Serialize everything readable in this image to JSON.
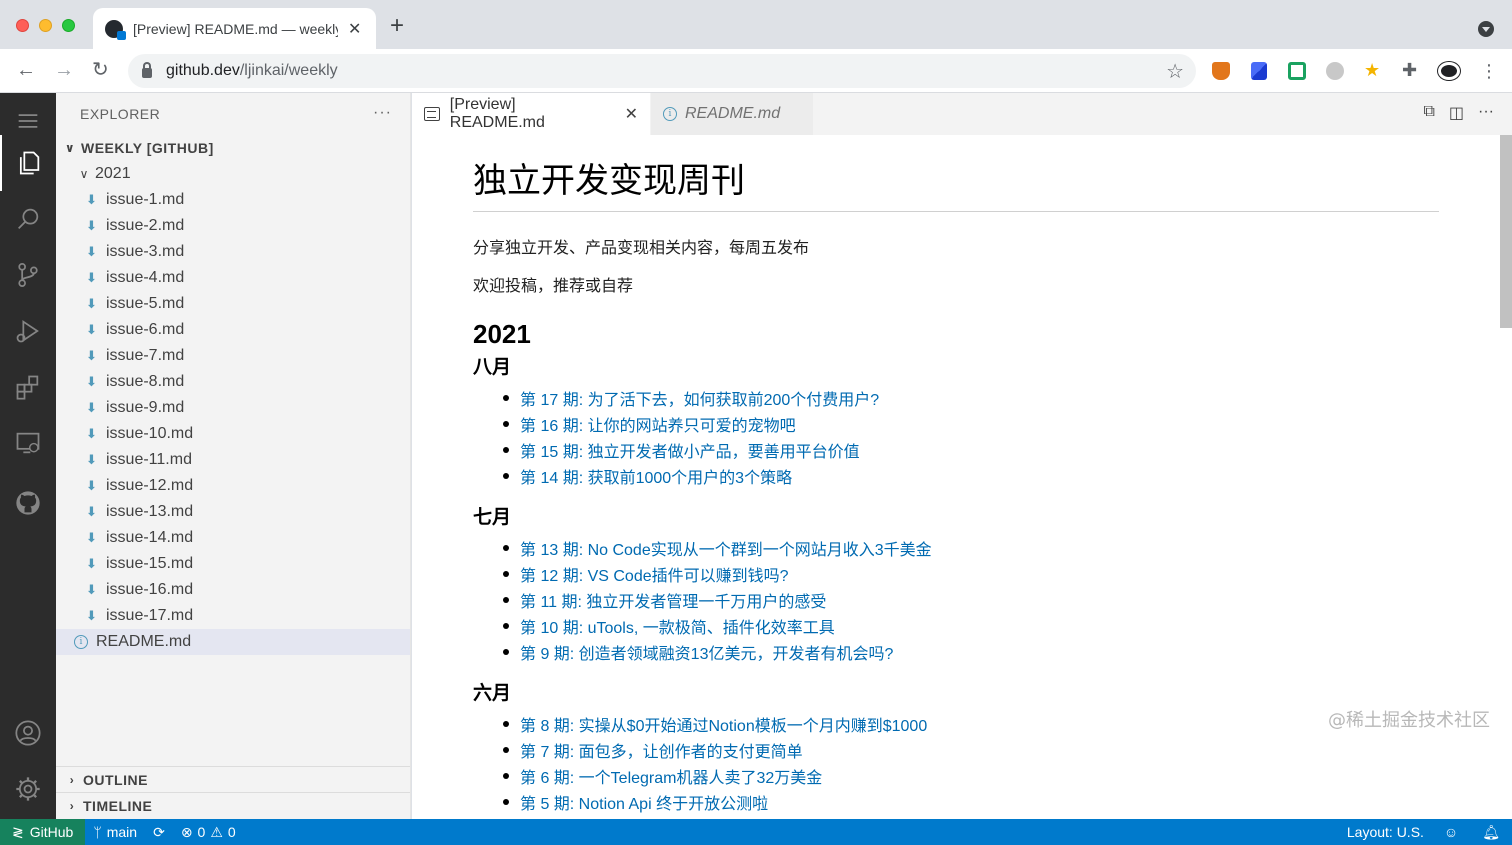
{
  "browser": {
    "tab_title": "[Preview] README.md — weekly",
    "tab_close": "✕",
    "new_tab": "+",
    "url_host": "github.dev",
    "url_path": "/ljinkai/weekly"
  },
  "explorer": {
    "header": "EXPLORER",
    "more": "···",
    "workspace": "WEEKLY [GITHUB]",
    "folder": "2021",
    "files": [
      "issue-1.md",
      "issue-2.md",
      "issue-3.md",
      "issue-4.md",
      "issue-5.md",
      "issue-6.md",
      "issue-7.md",
      "issue-8.md",
      "issue-9.md",
      "issue-10.md",
      "issue-11.md",
      "issue-12.md",
      "issue-13.md",
      "issue-14.md",
      "issue-15.md",
      "issue-16.md",
      "issue-17.md"
    ],
    "readme": "README.md",
    "outline": "OUTLINE",
    "timeline": "TIMELINE"
  },
  "editor": {
    "active_tab": "[Preview] README.md",
    "inactive_tab": "README.md"
  },
  "preview": {
    "title": "独立开发变现周刊",
    "intro": "分享独立开发、产品变现相关内容，每周五发布",
    "submit": "欢迎投稿，推荐或自荐",
    "year": "2021",
    "months": [
      {
        "name": "八月",
        "items": [
          "第 17 期: 为了活下去，如何获取前200个付费用户?",
          "第 16 期: 让你的网站养只可爱的宠物吧",
          "第 15 期: 独立开发者做小产品，要善用平台价值",
          "第 14 期: 获取前1000个用户的3个策略"
        ]
      },
      {
        "name": "七月",
        "items": [
          "第 13 期: No Code实现从一个群到一个网站月收入3千美金",
          "第 12 期: VS Code插件可以赚到钱吗?",
          "第 11 期: 独立开发者管理一千万用户的感受",
          "第 10 期: uTools, 一款极简、插件化效率工具",
          "第 9 期: 创造者领域融资13亿美元，开发者有机会吗?"
        ]
      },
      {
        "name": "六月",
        "items": [
          "第 8 期: 实操从$0开始通过Notion模板一个月内赚到$1000",
          "第 7 期: 面包多，让创作者的支付更简单",
          "第 6 期: 一个Telegram机器人卖了32万美金",
          "第 5 期: Notion Api 终于开放公测啦"
        ]
      }
    ]
  },
  "status": {
    "remote": "GitHub",
    "branch": "main",
    "errors": "0",
    "warnings": "0",
    "layout": "Layout: U.S."
  },
  "watermark": "@稀土掘金技术社区",
  "colors": {
    "accent": "#007acc",
    "link": "#006ab1",
    "remote": "#16825d"
  }
}
